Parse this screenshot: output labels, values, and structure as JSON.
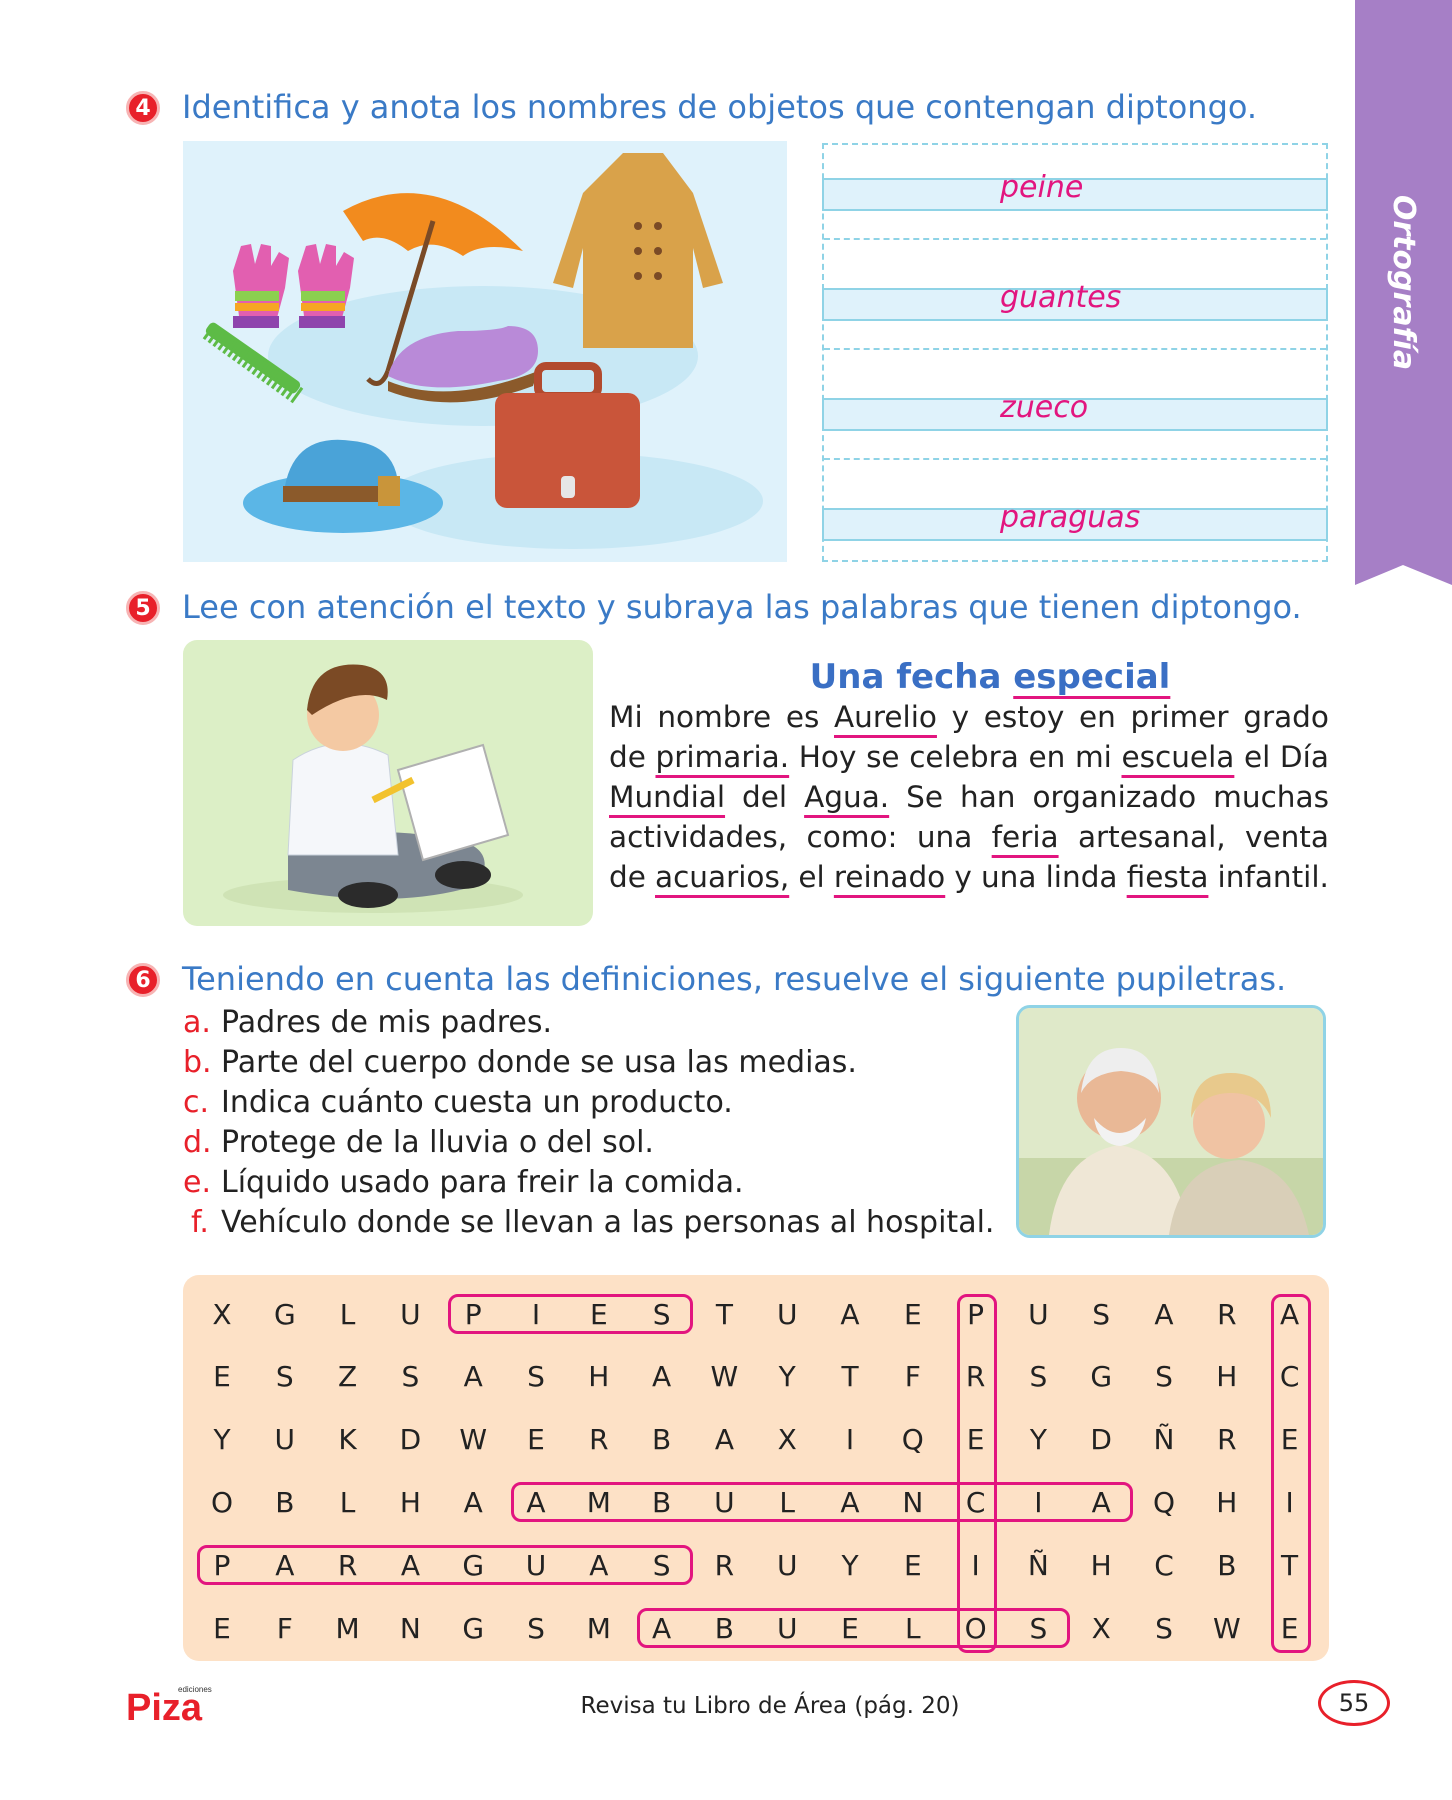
{
  "side_tab": {
    "label": "Ortografía"
  },
  "activity4": {
    "number": "4",
    "instruction": "Identifica y anota los nombres de objetos que contengan diptongo.",
    "answers": [
      "peine",
      "guantes",
      "zueco",
      "paraguas"
    ]
  },
  "activity5": {
    "number": "5",
    "instruction": "Lee con atención el texto y subraya las palabras que tienen diptongo.",
    "title_plain": "Una fecha",
    "title_underlined": "especial",
    "lines": [
      [
        {
          "t": "Mi"
        },
        {
          "t": "nombre"
        },
        {
          "t": "es"
        },
        {
          "t": "Aurelio",
          "u": true
        },
        {
          "t": "y"
        },
        {
          "t": "estoy"
        },
        {
          "t": "en"
        },
        {
          "t": "primer"
        },
        {
          "t": "grado"
        }
      ],
      [
        {
          "t": "de"
        },
        {
          "t": "primaria.",
          "u": true
        },
        {
          "t": "Hoy"
        },
        {
          "t": "se"
        },
        {
          "t": "celebra"
        },
        {
          "t": "en"
        },
        {
          "t": "mi"
        },
        {
          "t": "escuela",
          "u": true
        },
        {
          "t": "el"
        },
        {
          "t": "Día"
        }
      ],
      [
        {
          "t": "Mundial",
          "u": true
        },
        {
          "t": "del"
        },
        {
          "t": "Agua.",
          "u": true
        },
        {
          "t": "Se"
        },
        {
          "t": "han"
        },
        {
          "t": "organizado"
        },
        {
          "t": "muchas"
        }
      ],
      [
        {
          "t": "actividades,"
        },
        {
          "t": "como:"
        },
        {
          "t": "una"
        },
        {
          "t": "feria",
          "u": true
        },
        {
          "t": "artesanal,"
        },
        {
          "t": "venta"
        }
      ],
      [
        {
          "t": "de"
        },
        {
          "t": "acuarios,",
          "u": true
        },
        {
          "t": "el"
        },
        {
          "t": "reinado",
          "u": true
        },
        {
          "t": "y"
        },
        {
          "t": "una"
        },
        {
          "t": "linda"
        },
        {
          "t": "fiesta",
          "u": true
        },
        {
          "t": "infantil."
        }
      ]
    ]
  },
  "activity6": {
    "number": "6",
    "instruction": "Teniendo en cuenta las definiciones, resuelve el siguiente pupiletras.",
    "definitions": [
      {
        "letter": "a.",
        "text": "Padres de mis padres."
      },
      {
        "letter": "b.",
        "text": "Parte del cuerpo donde se usa las medias."
      },
      {
        "letter": "c.",
        "text": "Indica cuánto cuesta un producto."
      },
      {
        "letter": "d.",
        "text": "Protege de la lluvia o del sol."
      },
      {
        "letter": "e.",
        "text": "Líquido usado para freir la comida."
      },
      {
        "letter": "f.",
        "text": "Vehículo donde se llevan a las personas al hospital."
      }
    ],
    "grid": [
      [
        "X",
        "G",
        "L",
        "U",
        "P",
        "I",
        "E",
        "S",
        "T",
        "U",
        "A",
        "E",
        "P",
        "U",
        "S",
        "A",
        "R",
        "A"
      ],
      [
        "E",
        "S",
        "Z",
        "S",
        "A",
        "S",
        "H",
        "A",
        "W",
        "Y",
        "T",
        "F",
        "R",
        "S",
        "G",
        "S",
        "H",
        "C"
      ],
      [
        "Y",
        "U",
        "K",
        "D",
        "W",
        "E",
        "R",
        "B",
        "A",
        "X",
        "I",
        "Q",
        "E",
        "Y",
        "D",
        "Ñ",
        "R",
        "E"
      ],
      [
        "O",
        "B",
        "L",
        "H",
        "A",
        "A",
        "M",
        "B",
        "U",
        "L",
        "A",
        "N",
        "C",
        "I",
        "A",
        "Q",
        "H",
        "I"
      ],
      [
        "P",
        "A",
        "R",
        "A",
        "G",
        "U",
        "A",
        "S",
        "R",
        "U",
        "Y",
        "E",
        "I",
        "Ñ",
        "H",
        "C",
        "B",
        "T"
      ],
      [
        "E",
        "F",
        "M",
        "N",
        "G",
        "S",
        "M",
        "A",
        "B",
        "U",
        "E",
        "L",
        "O",
        "S",
        "X",
        "S",
        "W",
        "E"
      ]
    ],
    "found_words": [
      {
        "word": "PIES",
        "row": 0,
        "col": 4,
        "dir": "h",
        "len": 4
      },
      {
        "word": "AMBULANCIA",
        "row": 3,
        "col": 5,
        "dir": "h",
        "len": 10
      },
      {
        "word": "PARAGUAS",
        "row": 4,
        "col": 0,
        "dir": "h",
        "len": 8
      },
      {
        "word": "ABUELOS",
        "row": 5,
        "col": 7,
        "dir": "h",
        "len": 7
      },
      {
        "word": "PRECIO",
        "row": 0,
        "col": 12,
        "dir": "v",
        "len": 6
      },
      {
        "word": "ACEITE",
        "row": 0,
        "col": 17,
        "dir": "v",
        "len": 6
      }
    ]
  },
  "footer": {
    "brand": "Piza",
    "brand_small": "ediciones",
    "reference": "Revisa tu Libro de Área (pág. 20)",
    "page_number": "55"
  },
  "colors": {
    "accent_blue": "#3a7ac6",
    "answer_magenta": "#e2157f",
    "tab_purple": "#a67fc6",
    "number_red": "#e8202a"
  }
}
